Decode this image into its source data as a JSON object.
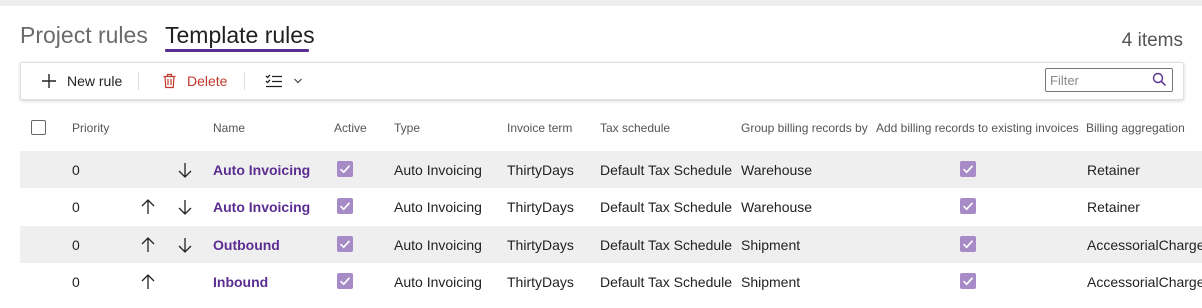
{
  "tabs": {
    "project": "Project rules",
    "template": "Template rules"
  },
  "item_count": "4 items",
  "toolbar": {
    "new_rule": "New rule",
    "delete": "Delete",
    "filter_placeholder": "Filter",
    "view_icon": "list-view-icon",
    "new_icon": "plus-icon",
    "delete_icon": "trash-icon",
    "search_icon": "search-icon"
  },
  "columns": {
    "priority": "Priority",
    "name": "Name",
    "active": "Active",
    "type": "Type",
    "invoice_term": "Invoice term",
    "tax_schedule": "Tax schedule",
    "group_by": "Group billing records by",
    "add_existing": "Add billing records to existing invoices",
    "aggregation": "Billing aggregation"
  },
  "rows": [
    {
      "priority": "0",
      "name": "Auto Invoicing",
      "type": "Auto Invoicing",
      "invoice_term": "ThirtyDays",
      "tax_schedule": "Default Tax Schedule",
      "group_by": "Warehouse",
      "aggregation": "Retainer",
      "active": true,
      "add_existing": true,
      "up": false,
      "down": true
    },
    {
      "priority": "0",
      "name": "Auto Invoicing",
      "type": "Auto Invoicing",
      "invoice_term": "ThirtyDays",
      "tax_schedule": "Default Tax Schedule",
      "group_by": "Warehouse",
      "aggregation": "Retainer",
      "active": true,
      "add_existing": true,
      "up": true,
      "down": true
    },
    {
      "priority": "0",
      "name": "Outbound",
      "type": "Auto Invoicing",
      "invoice_term": "ThirtyDays",
      "tax_schedule": "Default Tax Schedule",
      "group_by": "Shipment",
      "aggregation": "AccessorialCharge",
      "active": true,
      "add_existing": true,
      "up": true,
      "down": true
    },
    {
      "priority": "0",
      "name": "Inbound",
      "type": "Auto Invoicing",
      "invoice_term": "ThirtyDays",
      "tax_schedule": "Default Tax Schedule",
      "group_by": "Shipment",
      "aggregation": "AccessorialCharge",
      "active": true,
      "add_existing": true,
      "up": true,
      "down": false
    }
  ],
  "colors": {
    "accent": "#5c2d91",
    "checkbox": "#a78bc6",
    "delete": "#c0392b",
    "row_shade": "#efefef"
  }
}
